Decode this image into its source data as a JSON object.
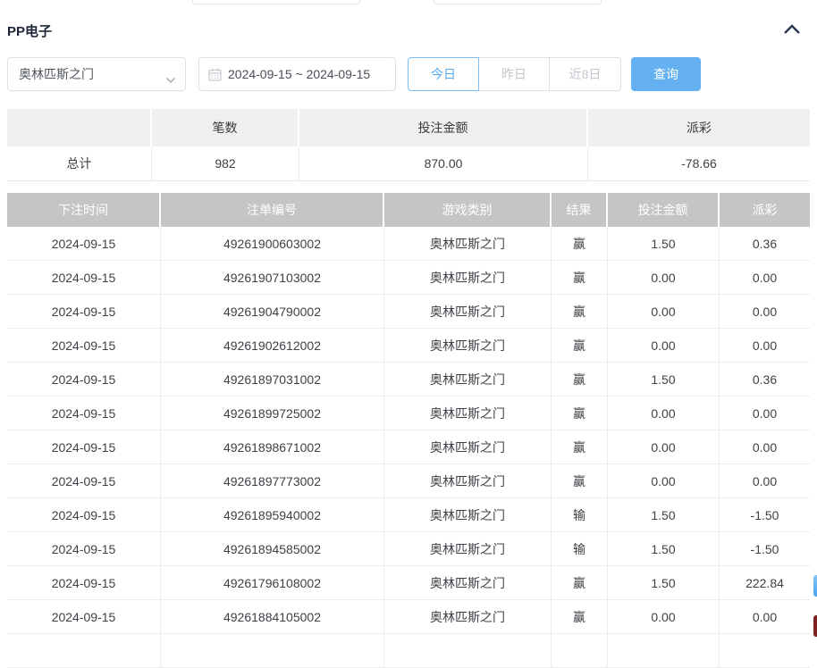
{
  "panel": {
    "title": "PP电子"
  },
  "icons": {
    "collapse": "chevron-up",
    "select_caret": "chevron-down",
    "date_picker": "calendar"
  },
  "filters": {
    "game_select": {
      "value": "奥林匹斯之门"
    },
    "date_range": {
      "value": "2024-09-15 ~ 2024-09-15"
    },
    "quick_ranges": [
      {
        "label": "今日",
        "active": true
      },
      {
        "label": "昨日",
        "active": false
      },
      {
        "label": "近8日",
        "active": false
      }
    ],
    "search_label": "查询"
  },
  "summary": {
    "columns": [
      "",
      "笔数",
      "投注金额",
      "派彩"
    ],
    "total": {
      "label": "总计",
      "count": "982",
      "bet_amount": "870.00",
      "payout": "-78.66"
    }
  },
  "table": {
    "columns": [
      "下注时间",
      "注单编号",
      "游戏类别",
      "结果",
      "投注金额",
      "派彩"
    ],
    "rows": [
      [
        "2024-09-15",
        "49261900603002",
        "奥林匹斯之门",
        "赢",
        "1.50",
        "0.36"
      ],
      [
        "2024-09-15",
        "49261907103002",
        "奥林匹斯之门",
        "赢",
        "0.00",
        "0.00"
      ],
      [
        "2024-09-15",
        "49261904790002",
        "奥林匹斯之门",
        "赢",
        "0.00",
        "0.00"
      ],
      [
        "2024-09-15",
        "49261902612002",
        "奥林匹斯之门",
        "赢",
        "0.00",
        "0.00"
      ],
      [
        "2024-09-15",
        "49261897031002",
        "奥林匹斯之门",
        "赢",
        "1.50",
        "0.36"
      ],
      [
        "2024-09-15",
        "49261899725002",
        "奥林匹斯之门",
        "赢",
        "0.00",
        "0.00"
      ],
      [
        "2024-09-15",
        "49261898671002",
        "奥林匹斯之门",
        "赢",
        "0.00",
        "0.00"
      ],
      [
        "2024-09-15",
        "49261897773002",
        "奥林匹斯之门",
        "赢",
        "0.00",
        "0.00"
      ],
      [
        "2024-09-15",
        "49261895940002",
        "奥林匹斯之门",
        "输",
        "1.50",
        "-1.50"
      ],
      [
        "2024-09-15",
        "49261894585002",
        "奥林匹斯之门",
        "输",
        "1.50",
        "-1.50"
      ],
      [
        "2024-09-15",
        "49261796108002",
        "奥林匹斯之门",
        "赢",
        "1.50",
        "222.84"
      ],
      [
        "2024-09-15",
        "49261884105002",
        "奥林匹斯之门",
        "赢",
        "0.00",
        "0.00"
      ]
    ]
  },
  "colors": {
    "accent_blue": "#64b0f0",
    "active_tab_blue": "#53a9f0",
    "negative_red": "#f25555",
    "table_header_gray": "#c5c5c5",
    "summary_header_gray": "#efefef"
  }
}
